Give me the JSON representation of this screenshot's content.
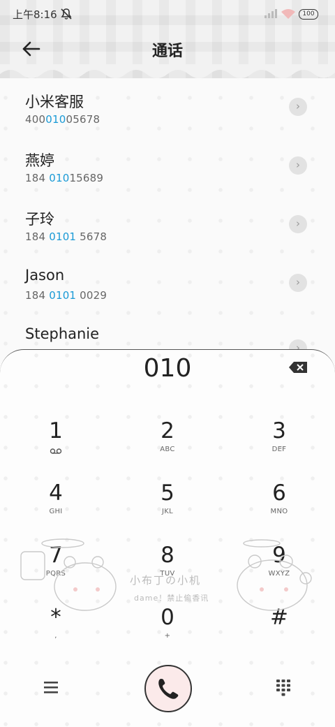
{
  "status": {
    "time": "上午8:16",
    "battery": "100"
  },
  "header": {
    "title": "通话"
  },
  "contacts": [
    {
      "name": "小米客服",
      "num_pre": "400",
      "num_hl": "010",
      "num_post": "05678"
    },
    {
      "name": "燕婷",
      "num_pre": "184 ",
      "num_hl": "010",
      "num_post": "15689"
    },
    {
      "name": "子玲",
      "num_pre": "184 ",
      "num_hl": "0101",
      "num_post": " 5678"
    },
    {
      "name": "Jason",
      "num_pre": "184 ",
      "num_hl": "0101",
      "num_post": " 0029"
    },
    {
      "name": "Stephanie",
      "num_pre": "",
      "num_hl": "",
      "num_post": ""
    }
  ],
  "dialer": {
    "input": "010",
    "keys": [
      {
        "digit": "1",
        "letters": ""
      },
      {
        "digit": "2",
        "letters": "ABC"
      },
      {
        "digit": "3",
        "letters": "DEF"
      },
      {
        "digit": "4",
        "letters": "GHI"
      },
      {
        "digit": "5",
        "letters": "JKL"
      },
      {
        "digit": "6",
        "letters": "MNO"
      },
      {
        "digit": "7",
        "letters": "PQRS"
      },
      {
        "digit": "8",
        "letters": "TUV"
      },
      {
        "digit": "9",
        "letters": "WXYZ"
      },
      {
        "digit": "*",
        "letters": ","
      },
      {
        "digit": "0",
        "letters": "+"
      },
      {
        "digit": "#",
        "letters": ""
      }
    ]
  },
  "watermark": {
    "line1": "小布丁の小机",
    "line2": "dame！禁止偷香讯"
  },
  "icons": {
    "back": "arrow-left-icon",
    "call": "phone-icon",
    "menu": "menu-icon",
    "keypad": "dialpad-icon",
    "backspace": "backspace-icon",
    "voicemail": "voicemail-icon"
  }
}
